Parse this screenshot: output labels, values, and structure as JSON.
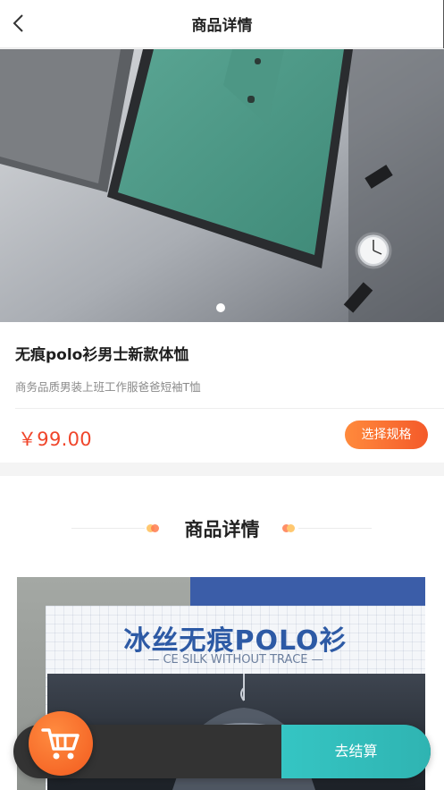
{
  "nav": {
    "back_icon": "chevron-left-icon",
    "title": "商品详情"
  },
  "gallery": {
    "image": "green-polo-shirt-in-box-with-watch",
    "slide_count": 1,
    "active_slide": 1
  },
  "product": {
    "name": "无痕polo衫男士新款体恤",
    "subtitle": "商务品质男装上班工作服爸爸短袖T恤",
    "price": "￥99.00",
    "spec_button": "选择规格"
  },
  "detail": {
    "heading": "商品详情",
    "banner_title": "冰丝无痕POLO衫",
    "banner_subtitle": "— CE SILK WITHOUT TRACE —"
  },
  "cart": {
    "cart_icon": "shopping-cart-icon",
    "checkout_label": "去结算"
  },
  "colors": {
    "accent_orange": "#f45a2a",
    "price_red": "#f0452a",
    "checkout_teal": "#35c5c3",
    "banner_blue": "#2d5aa5"
  }
}
